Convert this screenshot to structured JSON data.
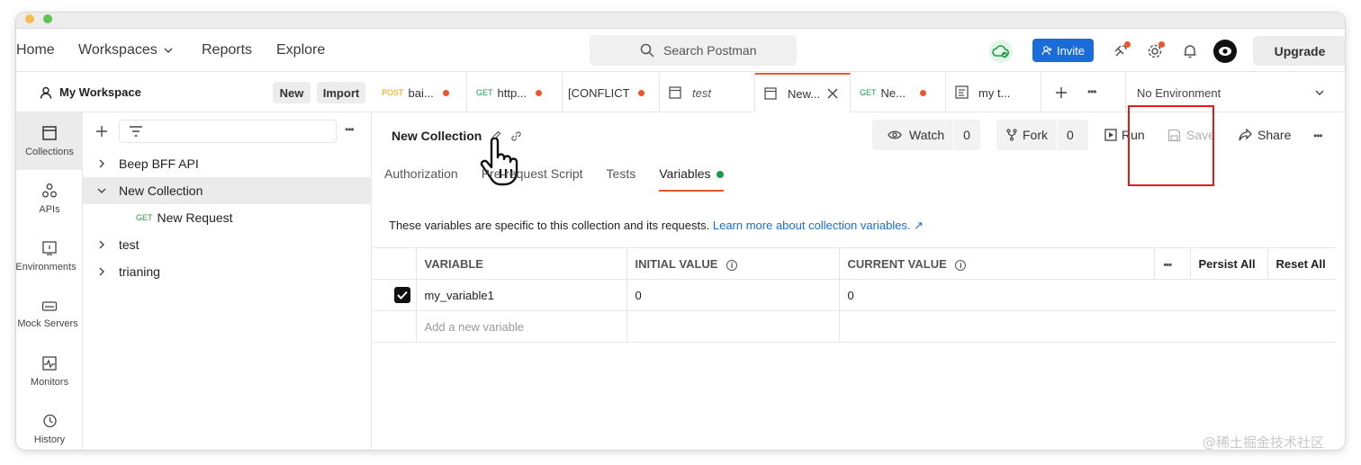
{
  "header": {
    "nav": [
      "Home",
      "Workspaces",
      "Reports",
      "Explore"
    ],
    "search_placeholder": "Search Postman",
    "invite_label": "Invite",
    "upgrade_label": "Upgrade"
  },
  "workspace": {
    "title": "My Workspace",
    "new_label": "New",
    "import_label": "Import"
  },
  "leftbar": {
    "items": [
      "Collections",
      "APIs",
      "Environments",
      "Mock Servers",
      "Monitors",
      "History"
    ]
  },
  "tree": {
    "items": [
      {
        "label": "Beep BFF API"
      },
      {
        "label": "New Collection"
      },
      {
        "method": "GET",
        "label": "New Request"
      },
      {
        "label": "test"
      },
      {
        "label": "trianing"
      }
    ]
  },
  "tabs": [
    {
      "method": "POST",
      "label": "bai..."
    },
    {
      "method": "GET",
      "label": "http..."
    },
    {
      "method": "",
      "label": "[CONFLICT]"
    },
    {
      "method": "",
      "label": "test"
    },
    {
      "method": "",
      "label": "New..."
    },
    {
      "method": "GET",
      "label": "Ne..."
    },
    {
      "method": "",
      "label": "my t..."
    }
  ],
  "environment": {
    "label": "No Environment"
  },
  "collection": {
    "title": "New Collection",
    "watch_label": "Watch",
    "watch_count": "0",
    "fork_label": "Fork",
    "fork_count": "0",
    "run_label": "Run",
    "save_label": "Save",
    "share_label": "Share",
    "more_label": "•••"
  },
  "subtabs": [
    "Authorization",
    "Pre-request Script",
    "Tests",
    "Variables"
  ],
  "info": {
    "text": "These variables are specific to this collection and its requests.",
    "link": "Learn more about collection variables. ↗"
  },
  "table": {
    "headers": {
      "variable": "VARIABLE",
      "initial": "INITIAL VALUE",
      "current": "CURRENT VALUE",
      "more": "•••",
      "persist": "Persist All",
      "reset": "Reset All"
    },
    "rows": [
      {
        "variable": "my_variable1",
        "initial": "0",
        "current": "0"
      }
    ],
    "add_placeholder": "Add a new variable"
  },
  "watermark": "@稀土掘金技术社区"
}
